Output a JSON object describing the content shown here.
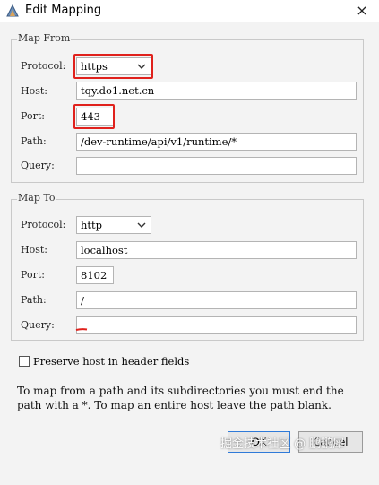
{
  "window": {
    "title": "Edit Mapping",
    "close_glyph": "×"
  },
  "map_from": {
    "legend": "Map From",
    "protocol_label": "Protocol:",
    "protocol_value": "https",
    "host_label": "Host:",
    "host_value": "tqy.do1.net.cn",
    "port_label": "Port:",
    "port_value": "443",
    "path_label": "Path:",
    "path_value": "/dev-runtime/api/v1/runtime/*",
    "query_label": "Query:",
    "query_value": ""
  },
  "map_to": {
    "legend": "Map To",
    "protocol_label": "Protocol:",
    "protocol_value": "http",
    "host_label": "Host:",
    "host_value": "localhost",
    "port_label": "Port:",
    "port_value": "8102",
    "path_label": "Path:",
    "path_value": "/",
    "query_label": "Query:",
    "query_value": ""
  },
  "preserve_host": {
    "label": "Preserve host in header fields",
    "checked": false
  },
  "help_text": "To map from a path and its subdirectories you must end the path with a *. To map an entire host leave the path blank.",
  "buttons": {
    "ok_label": "OK",
    "cancel_label": "Cancel"
  },
  "watermark": "掘金技术社区 @ 鹏鹏犀",
  "annotation_color": "#e0211c"
}
